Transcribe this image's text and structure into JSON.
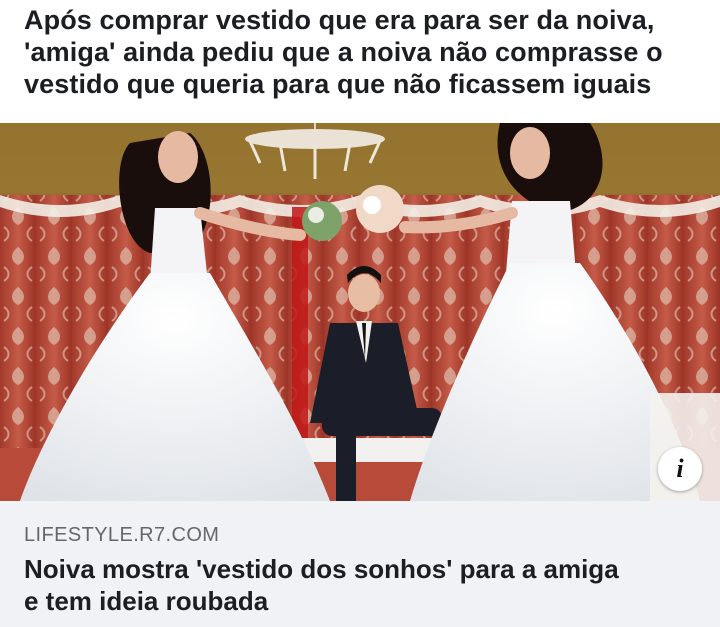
{
  "post": {
    "text_lines": [
      "Após comprar vestido que era para ser da noiva,",
      "'amiga' ainda pediu que a noiva não comprasse o",
      "vestido que queria para que não ficassem iguais"
    ]
  },
  "link_preview": {
    "info_icon": "info-icon",
    "domain": "LIFESTYLE.R7.COM",
    "title_lines": [
      "Noiva mostra 'vestido dos sonhos' para a amiga",
      "e tem ideia roubada"
    ]
  }
}
